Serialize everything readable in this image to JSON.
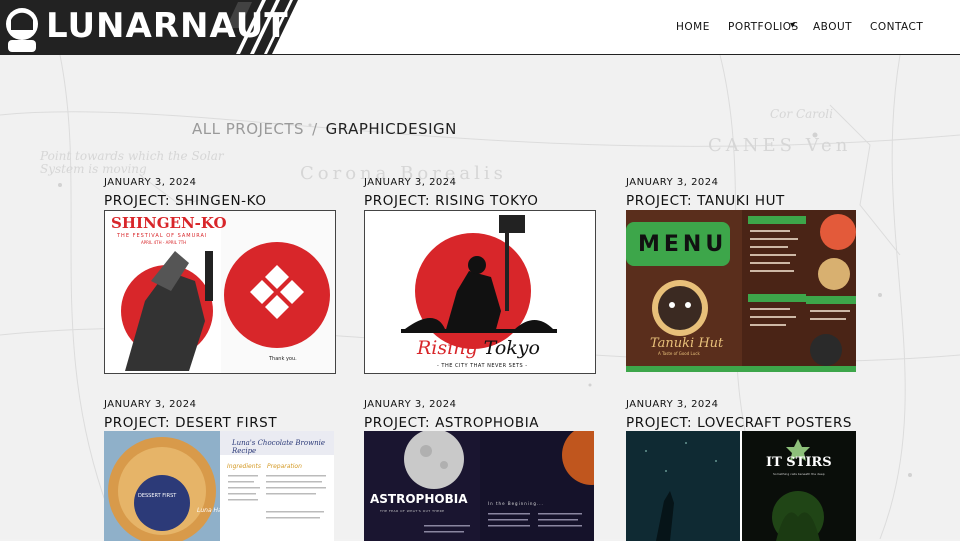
{
  "header": {
    "logo": "LUNARNAUT",
    "nav": {
      "home": "HOME",
      "portfolios": "PORTFOLIOS",
      "portfolios_caret": "▾",
      "about": "ABOUT",
      "contact": "CONTACT"
    }
  },
  "background": {
    "labels": [
      "Corona Borealis",
      "CANES Ven",
      "Cor Caroli",
      "Point towards which the Solar System is moving"
    ]
  },
  "breadcrumb": {
    "parent": "ALL PROJECTS",
    "separator": "/",
    "current": "GRAPHICDESIGN"
  },
  "projects": [
    {
      "date": "JANUARY 3, 2024",
      "title": "PROJECT: SHINGEN-KO",
      "thumb": {
        "title": "SHINGEN-KO",
        "subtitle": "THE FESTIVAL OF SAMURAI",
        "dates": "APRIL 4TH - APRIL 7TH",
        "thanks": "Thank you."
      }
    },
    {
      "date": "JANUARY 3, 2024",
      "title": "PROJECT: RISING TOKYO",
      "thumb": {
        "logo_red": "Rising",
        "logo_black": "Tokyo",
        "tagline": "- THE CITY THAT NEVER SETS -"
      }
    },
    {
      "date": "JANUARY 3, 2024",
      "title": "PROJECT: TANUKI HUT",
      "thumb": {
        "menu": "MENU",
        "brand": "Tanuki Hut",
        "slogan": "A Taste of Good Luck"
      }
    },
    {
      "date": "JANUARY 3, 2024",
      "title": "PROJECT: DESERT FIRST",
      "thumb": {
        "heading": "Luna's Chocolate Brownie Recipe",
        "ingredients": "Ingredients",
        "preparation": "Preparation",
        "badge": "DESSERT FIRST",
        "name": "Luna Hart"
      }
    },
    {
      "date": "JANUARY 3, 2024",
      "title": "PROJECT: ASTROPHOBIA",
      "thumb": {
        "title": "ASTROPHOBIA",
        "subtitle": "THE FEAR OF WHAT'S OUT THERE",
        "begin": "In the Beginning..."
      }
    },
    {
      "date": "JANUARY 3, 2024",
      "title": "PROJECT: LOVECRAFT POSTERS",
      "thumb": {
        "title": "IT STIRS",
        "subtitle": "Something calls beneath the deep"
      }
    }
  ],
  "colors": {
    "accent_red": "#d8262a",
    "menu_green": "#3da64a",
    "recipe_navy": "#2c3a78"
  }
}
